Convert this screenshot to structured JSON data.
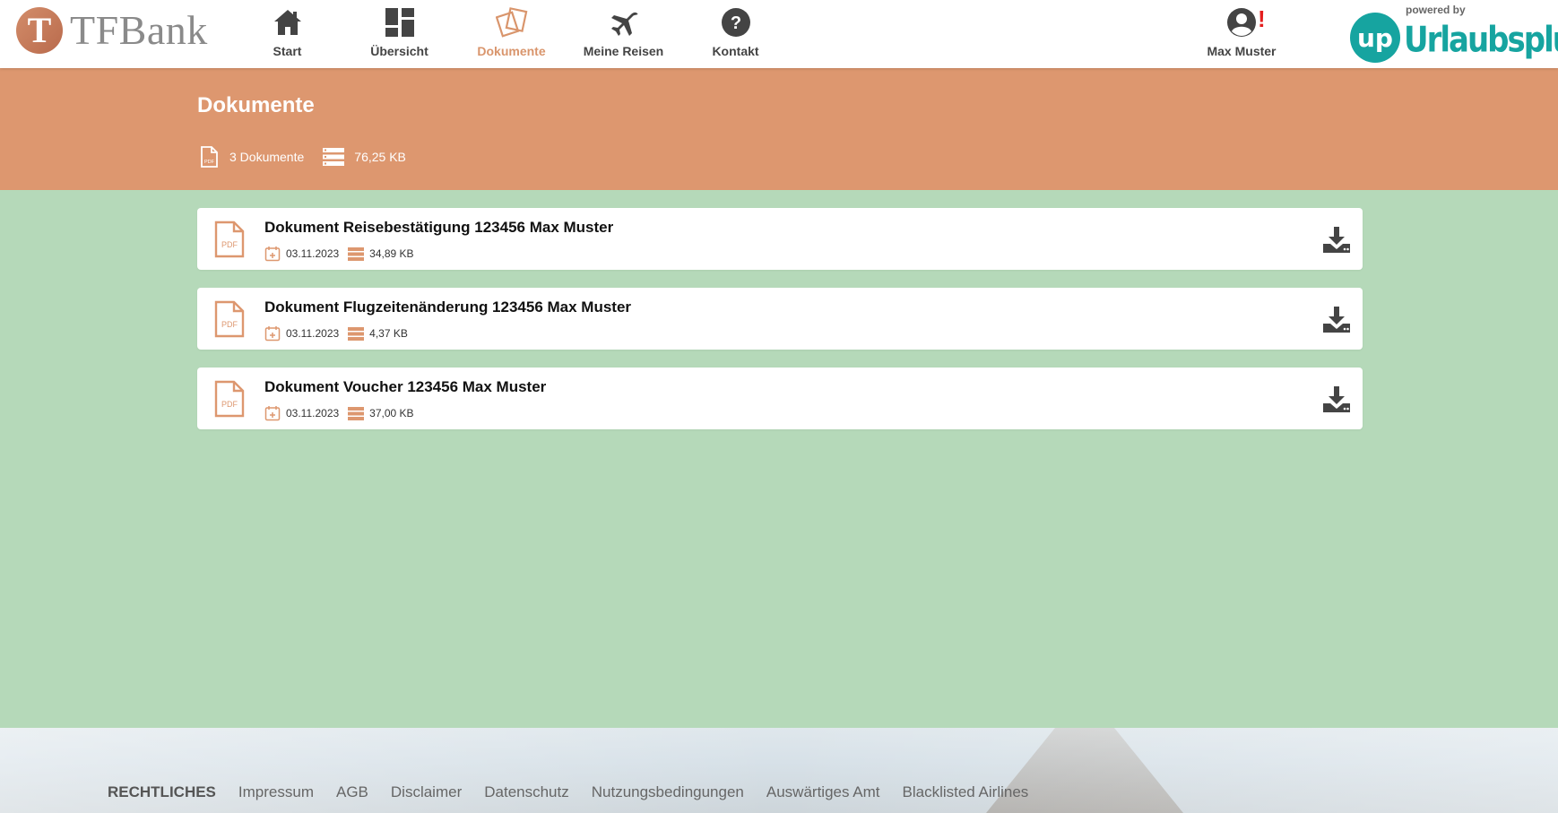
{
  "header": {
    "logo_text": "TFBank",
    "logo_mark": "T",
    "nav": [
      {
        "label": "Start",
        "icon": "home-icon"
      },
      {
        "label": "Übersicht",
        "icon": "dashboard-icon"
      },
      {
        "label": "Dokumente",
        "icon": "documents-icon",
        "active": true
      },
      {
        "label": "Meine Reisen",
        "icon": "airplane-icon"
      },
      {
        "label": "Kontakt",
        "icon": "question-icon"
      }
    ],
    "user": {
      "name": "Max Muster",
      "alert": "!"
    },
    "powered_by": {
      "small": "powered by",
      "badge": "up",
      "brand": "Urlaubsplus"
    }
  },
  "banner": {
    "title": "Dokumente",
    "count_label": "3 Dokumente",
    "size_label": "76,25 KB"
  },
  "documents": [
    {
      "title": "Dokument Reisebestätigung 123456 Max Muster",
      "date": "03.11.2023",
      "size": "34,89 KB"
    },
    {
      "title": "Dokument Flugzeitenänderung 123456 Max Muster",
      "date": "03.11.2023",
      "size": "4,37 KB"
    },
    {
      "title": "Dokument Voucher 123456 Max Muster",
      "date": "03.11.2023",
      "size": "37,00 KB"
    }
  ],
  "footer": {
    "heading": "RECHTLICHES",
    "links": [
      "Impressum",
      "AGB",
      "Disclaimer",
      "Datenschutz",
      "Nutzungsbedingungen",
      "Auswärtiges Amt",
      "Blacklisted Airlines"
    ]
  },
  "colors": {
    "accent": "#dd976f",
    "background": "#b5d9b9",
    "brand_teal": "#16a4a0",
    "alert": "#e41e1e"
  },
  "pdf_icon_text": "PDF"
}
